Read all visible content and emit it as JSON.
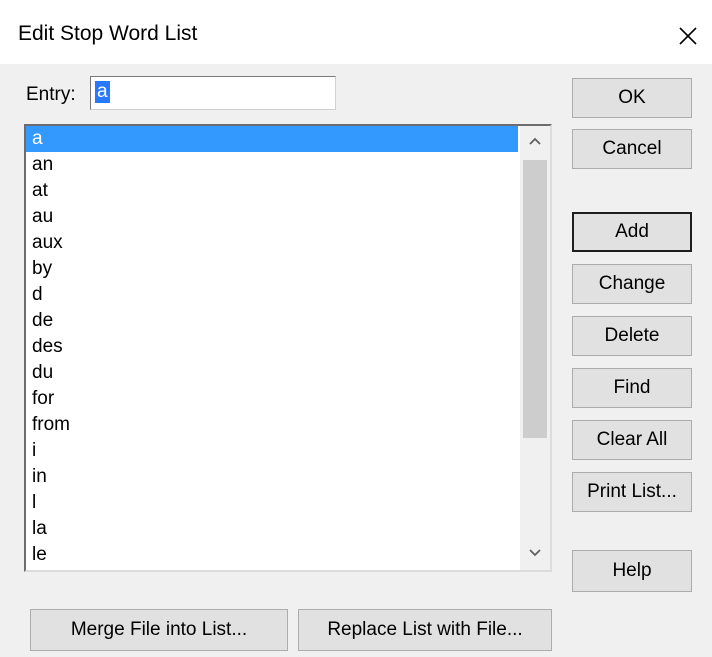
{
  "window": {
    "title": "Edit Stop Word List",
    "close_icon": "close-icon"
  },
  "entry": {
    "label": "Entry:",
    "value": "a"
  },
  "stopword_list": {
    "selected_index": 0,
    "items": [
      "a",
      "an",
      "at",
      "au",
      "aux",
      "by",
      "d",
      "de",
      "des",
      "du",
      "for",
      "from",
      "i",
      "in",
      "l",
      "la",
      "le"
    ]
  },
  "scrollbar": {
    "up_icon": "chevron-up-icon",
    "down_icon": "chevron-down-icon"
  },
  "buttons": {
    "ok": "OK",
    "cancel": "Cancel",
    "add": "Add",
    "change": "Change",
    "delete": "Delete",
    "find": "Find",
    "clear_all": "Clear All",
    "print_list": "Print List...",
    "help": "Help",
    "merge_file": "Merge File into List...",
    "replace_list": "Replace List with File..."
  },
  "colors": {
    "selection": "#3399ff",
    "dialog_background": "#f0f0f0",
    "title_background": "#ffffff"
  }
}
